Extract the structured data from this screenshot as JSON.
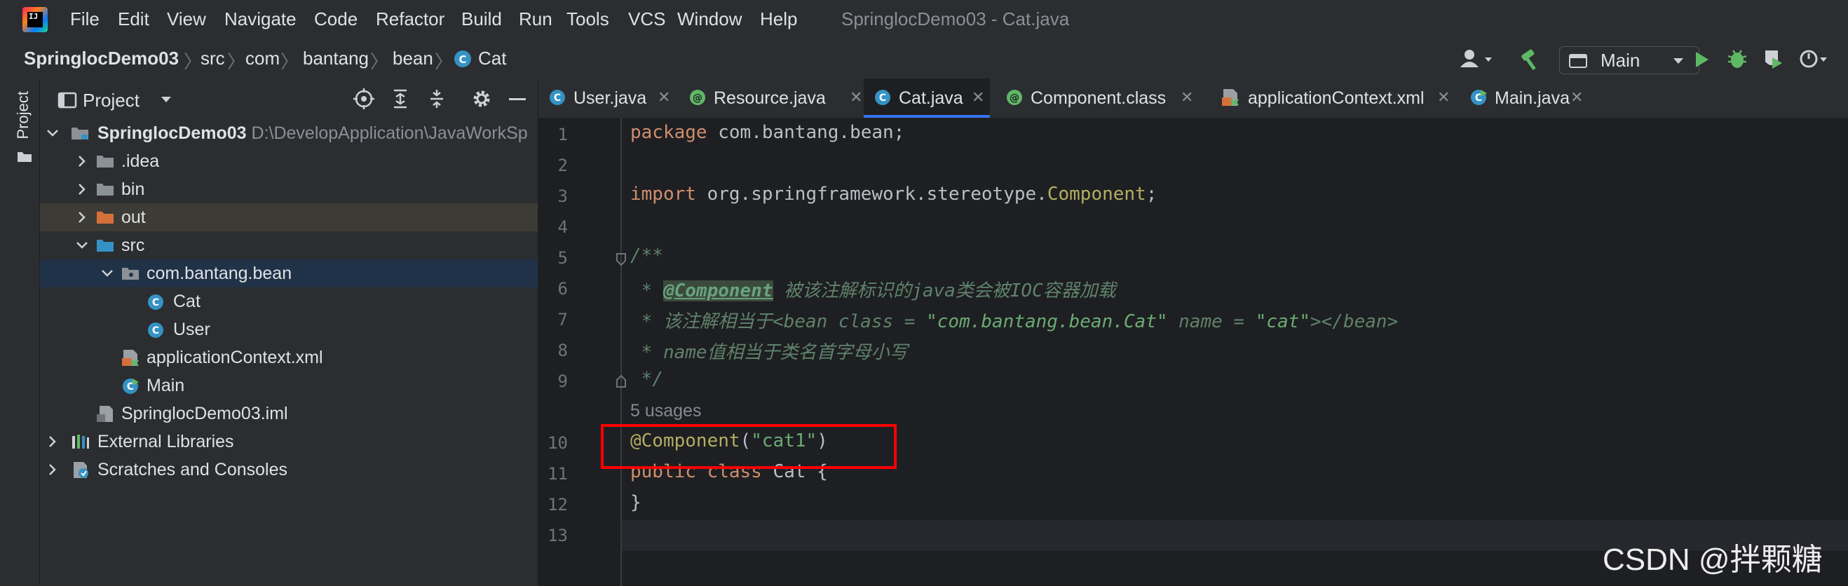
{
  "menu": {
    "items": [
      "File",
      "Edit",
      "View",
      "Navigate",
      "Code",
      "Refactor",
      "Build",
      "Run",
      "Tools",
      "VCS",
      "Window",
      "Help"
    ],
    "window_title": "SpringlocDemo03 - Cat.java"
  },
  "breadcrumb": [
    "SpringlocDemo03",
    "src",
    "com",
    "bantang",
    "bean",
    "Cat"
  ],
  "toolbar": {
    "run_config": "Main"
  },
  "tool_strip": {
    "label": "Project"
  },
  "project": {
    "title": "Project",
    "tree": [
      {
        "label": "SpringlocDemo03",
        "path": "D:\\DevelopApplication\\JavaWorkSp",
        "icon": "module-folder-icon"
      },
      {
        "label": ".idea",
        "icon": "folder-icon"
      },
      {
        "label": "bin",
        "icon": "folder-icon"
      },
      {
        "label": "out",
        "icon": "excluded-folder-icon"
      },
      {
        "label": "src",
        "icon": "source-folder-icon"
      },
      {
        "label": "com.bantang.bean",
        "icon": "package-icon"
      },
      {
        "label": "Cat",
        "icon": "class-icon"
      },
      {
        "label": "User",
        "icon": "class-icon"
      },
      {
        "label": "applicationContext.xml",
        "icon": "xml-file-icon"
      },
      {
        "label": "Main",
        "icon": "main-class-icon"
      },
      {
        "label": "SpringlocDemo03.iml",
        "icon": "iml-file-icon"
      },
      {
        "label": "External Libraries",
        "icon": "libraries-icon"
      },
      {
        "label": "Scratches and Consoles",
        "icon": "scratches-icon"
      }
    ]
  },
  "tabs": [
    {
      "label": "User.java",
      "icon": "class-icon"
    },
    {
      "label": "Resource.java",
      "icon": "annotation-icon"
    },
    {
      "label": "Cat.java",
      "icon": "class-icon",
      "active": true
    },
    {
      "label": "Component.class",
      "icon": "annotation-icon"
    },
    {
      "label": "applicationContext.xml",
      "icon": "xml-file-icon"
    },
    {
      "label": "Main.java",
      "icon": "main-class-icon"
    }
  ],
  "editor": {
    "line_numbers": [
      "1",
      "2",
      "3",
      "4",
      "5",
      "6",
      "7",
      "8",
      "9",
      "10",
      "11",
      "12",
      "13"
    ],
    "l1_kw": "package",
    "l1_rest": " com.bantang.bean;",
    "l3_kw": "import",
    "l3_rest": " org.springframework.stereotype.",
    "l3_cls": "Component",
    "l3_end": ";",
    "l5": "/**",
    "l6_star": " * ",
    "l6_tag": "@Component",
    "l6_text": " 被该注解标识的java类会被IOC容器加载",
    "l7_a": " * 该注解相当于<bean class = ",
    "l7_s1": "\"com.bantang.bean.Cat\"",
    "l7_b": " name = ",
    "l7_s2": "\"cat\"",
    "l7_c": "></bean>",
    "l8": " * name值相当于类名首字母小写",
    "l9": " */",
    "usages": "5 usages",
    "l10_ann": "@Component",
    "l10_open": "(",
    "l10_str": "\"cat1\"",
    "l10_close": ")",
    "l11_kw": "public class",
    "l11_rest": " Cat {",
    "l12": "}"
  },
  "watermark": "CSDN @拌颗糖"
}
